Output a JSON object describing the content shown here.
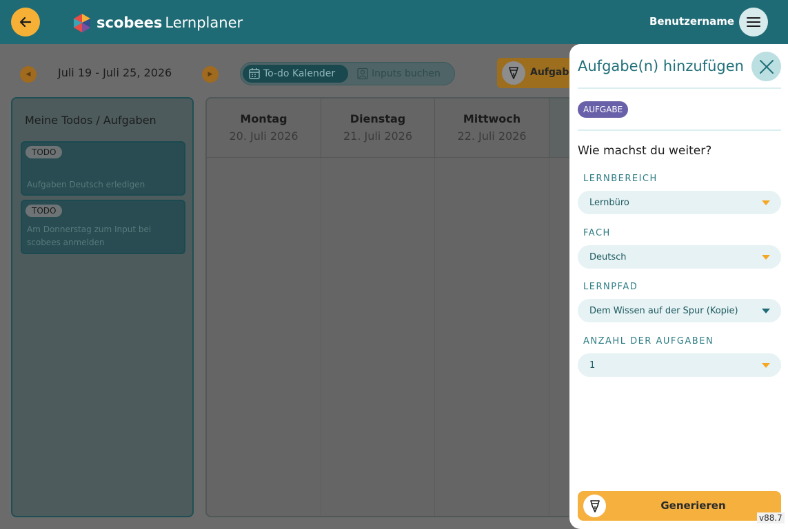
{
  "header": {
    "logo_brand": "scobees",
    "logo_product": "Lernplaner",
    "username": "Benutzername",
    "icons": {
      "back": "arrow-left-icon",
      "menu": "hamburger-menu-icon"
    }
  },
  "week": {
    "range": "Juli 19 - Juli 25, 2026"
  },
  "view_toggle": {
    "calendar_label": "To-do Kalender",
    "inputs_label": "Inputs buchen"
  },
  "aufgabe_button_label": "Aufgabe",
  "todos": {
    "title": "Meine Todos / Aufgaben",
    "items": [
      {
        "badge": "TODO",
        "text": "Aufgaben Deutsch erledigen"
      },
      {
        "badge": "TODO",
        "text": "Am Donnerstag zum Input bei scobees anmelden"
      }
    ]
  },
  "calendar": {
    "days": [
      {
        "day": "Montag",
        "date": "20. Juli 2026"
      },
      {
        "day": "Dienstag",
        "date": "21. Juli 2026"
      },
      {
        "day": "Mittwoch",
        "date": "22. Juli 2026"
      }
    ]
  },
  "drawer": {
    "title": "Aufgabe(n) hinzufügen",
    "badge": "AUFGABE",
    "question": "Wie machst du weiter?",
    "fields": [
      {
        "label": "LERNBEREICH",
        "value": "Lernbüro"
      },
      {
        "label": "FACH",
        "value": "Deutsch"
      },
      {
        "label": "LERNPFAD",
        "value": "Dem Wissen auf der Spur (Kopie)"
      },
      {
        "label": "ANZAHL DER AUFGABEN",
        "value": "1"
      }
    ],
    "generate_label": "Generieren"
  },
  "version": "v88.7",
  "colors": {
    "header_bg": "#1f6b75",
    "accent_orange": "#f5b035",
    "badge_purple": "#6860a8",
    "title_teal": "#1f6f79"
  }
}
